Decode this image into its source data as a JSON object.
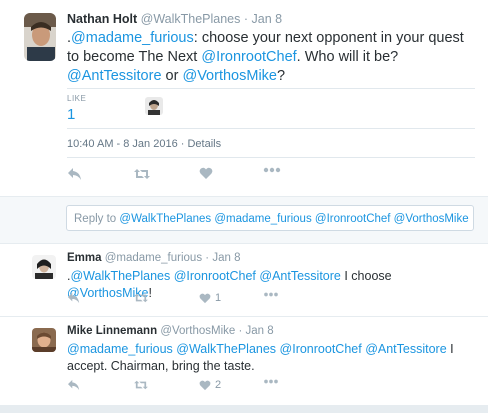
{
  "main_tweet": {
    "author_name": "Nathan Holt",
    "author_handle": "@WalkThePlanes",
    "dot": "·",
    "time": "Jan 8",
    "text_segments": [
      {
        "text": ".",
        "link": false
      },
      {
        "text": "@madame_furious",
        "link": true
      },
      {
        "text": ": choose your next opponent in your quest to become The Next ",
        "link": false
      },
      {
        "text": "@IronrootChef",
        "link": true
      },
      {
        "text": ". Who will it be? ",
        "link": false
      },
      {
        "text": "@AntTessitore",
        "link": true
      },
      {
        "text": " or ",
        "link": false
      },
      {
        "text": "@VorthosMike",
        "link": true
      },
      {
        "text": "?",
        "link": false
      }
    ],
    "likes_label": "LIKE",
    "likes_count": "1",
    "timestamp": "10:40 AM - 8 Jan 2016",
    "details_label": "Details"
  },
  "reply_box": {
    "prefix": "Reply to ",
    "mentions": "@WalkThePlanes @madame_furious @IronrootChef @VorthosMike"
  },
  "replies": [
    {
      "author_name": "Emma",
      "author_handle": "@madame_furious",
      "dot": "·",
      "time": "Jan 8",
      "text_segments": [
        {
          "text": ".",
          "link": false
        },
        {
          "text": "@WalkThePlanes",
          "link": true
        },
        {
          "text": " ",
          "link": false
        },
        {
          "text": "@IronrootChef",
          "link": true
        },
        {
          "text": " ",
          "link": false
        },
        {
          "text": "@AntTessitore",
          "link": true
        },
        {
          "text": " I choose ",
          "link": false
        },
        {
          "text": "@VorthosMike",
          "link": true
        },
        {
          "text": "!",
          "link": false
        }
      ],
      "like_count": "1"
    },
    {
      "author_name": "Mike Linnemann",
      "author_handle": "@VorthosMike",
      "dot": "·",
      "time": "Jan 8",
      "text_segments": [
        {
          "text": "@madame_furious",
          "link": true
        },
        {
          "text": " ",
          "link": false
        },
        {
          "text": "@WalkThePlanes",
          "link": true
        },
        {
          "text": " ",
          "link": false
        },
        {
          "text": "@IronrootChef",
          "link": true
        },
        {
          "text": " ",
          "link": false
        },
        {
          "text": "@AntTessitore",
          "link": true
        },
        {
          "text": " I accept. Chairman, bring the taste.",
          "link": false
        }
      ],
      "like_count": "2"
    }
  ],
  "icons": {
    "reply": "reply-icon",
    "retweet": "retweet-icon",
    "like": "heart-icon",
    "more": "more-icon"
  },
  "colors": {
    "link": "#1b95e0",
    "muted": "#8899a6",
    "text": "#292f33",
    "divider": "#e1e8ed",
    "reply_bg": "#f5f8fa"
  }
}
